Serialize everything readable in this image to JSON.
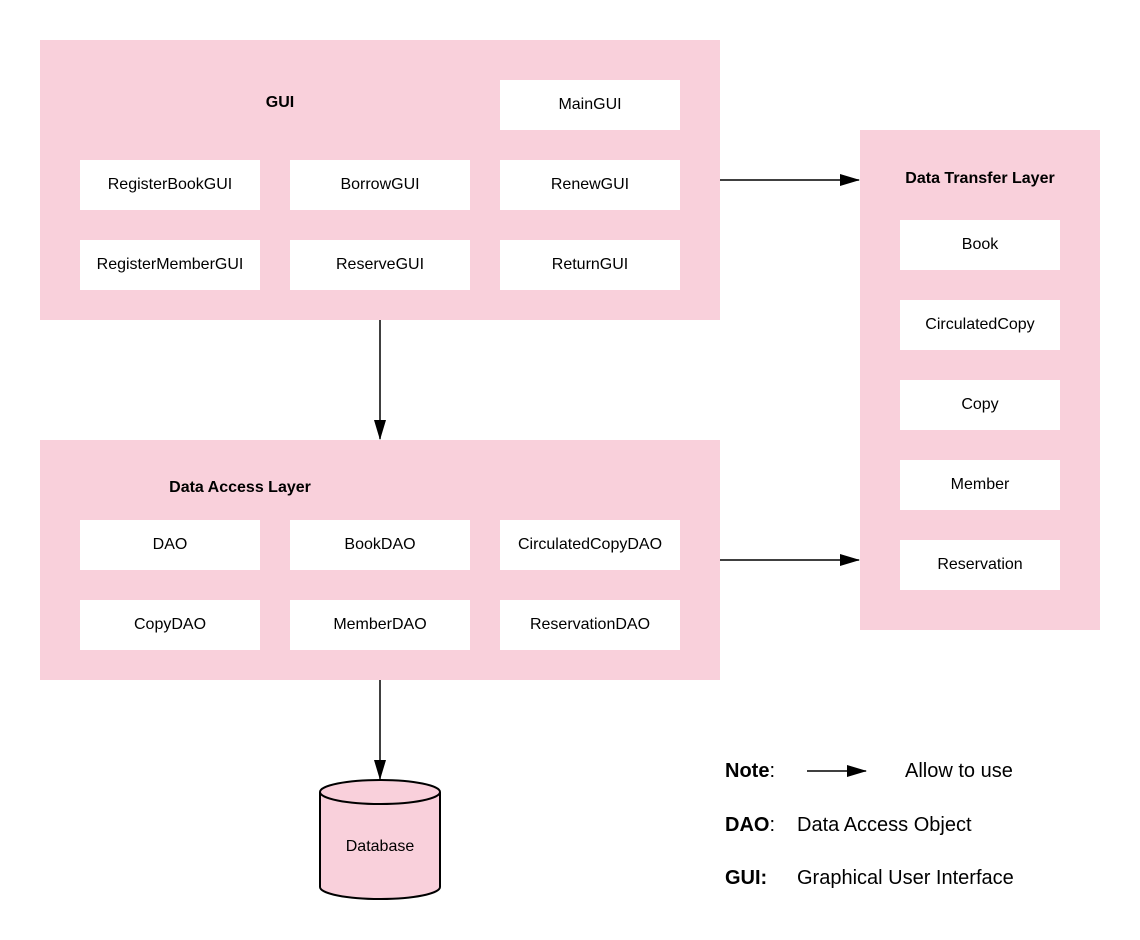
{
  "colors": {
    "layer_fill": "#f9d0db",
    "box_fill": "#ffffff",
    "stroke": "#000000"
  },
  "gui_layer": {
    "title": "GUI",
    "components": [
      "MainGUI",
      "RegisterBookGUI",
      "BorrowGUI",
      "RenewGUI",
      "RegisterMemberGUI",
      "ReserveGUI",
      "ReturnGUI"
    ]
  },
  "data_transfer_layer": {
    "title": "Data Transfer Layer",
    "components": [
      "Book",
      "CirculatedCopy",
      "Copy",
      "Member",
      "Reservation"
    ]
  },
  "data_access_layer": {
    "title": "Data Access Layer",
    "components": [
      "DAO",
      "BookDAO",
      "CirculatedCopyDAO",
      "CopyDAO",
      "MemberDAO",
      "ReservationDAO"
    ]
  },
  "database": {
    "label": "Database"
  },
  "legend": {
    "note_label": "Note",
    "note_colon": ":",
    "note_text": "Allow to use",
    "dao_label": "DAO",
    "dao_colon": ":",
    "dao_text": "Data Access Object",
    "gui_label": "GUI:",
    "gui_text": "Graphical User Interface"
  }
}
